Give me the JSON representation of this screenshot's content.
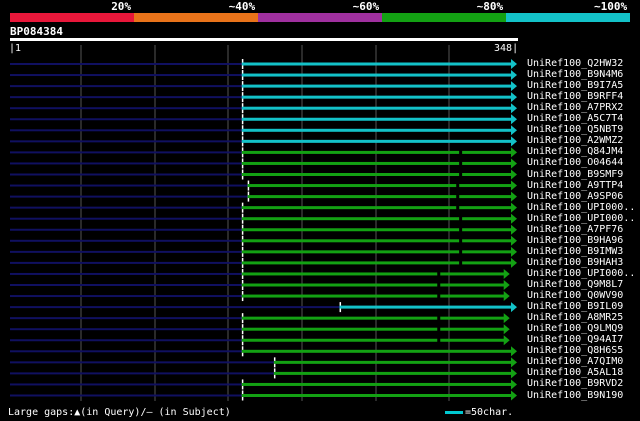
{
  "legend": {
    "segments": [
      {
        "label": "20%",
        "color": "#e8173a"
      },
      {
        "label": "~40%",
        "color": "#e8731a"
      },
      {
        "label": "~60%",
        "color": "#a0309f"
      },
      {
        "label": "~80%",
        "color": "#13a113"
      },
      {
        "label": "~100%",
        "color": "#13c2c8"
      }
    ]
  },
  "query": {
    "id": "BP084384",
    "length": 348,
    "scale_start": "1",
    "scale_end": "348"
  },
  "colors": {
    "grid": "#555555",
    "unaligned": "#101060",
    "cyan": "#13c2c8",
    "green": "#13a113",
    "gap_mark": "#000000"
  },
  "hits": [
    {
      "name": "UniRef100_Q2HW32",
      "start": 160,
      "end": 348,
      "color": "cyan"
    },
    {
      "name": "UniRef100_B9N4M6",
      "start": 160,
      "end": 348,
      "color": "cyan"
    },
    {
      "name": "UniRef100_B9I7A5",
      "start": 160,
      "end": 348,
      "color": "cyan"
    },
    {
      "name": "UniRef100_B9RFF4",
      "start": 160,
      "end": 348,
      "color": "cyan"
    },
    {
      "name": "UniRef100_A7PRX2",
      "start": 160,
      "end": 348,
      "color": "cyan"
    },
    {
      "name": "UniRef100_A5C7T4",
      "start": 160,
      "end": 348,
      "color": "cyan"
    },
    {
      "name": "UniRef100_Q5NBT9",
      "start": 160,
      "end": 348,
      "color": "cyan"
    },
    {
      "name": "UniRef100_A2WMZ2",
      "start": 160,
      "end": 348,
      "color": "cyan"
    },
    {
      "name": "UniRef100_Q84JM4",
      "start": 160,
      "end": 348,
      "color": "green",
      "gap": 309
    },
    {
      "name": "UniRef100_O04644",
      "start": 160,
      "end": 348,
      "color": "green",
      "gap": 309
    },
    {
      "name": "UniRef100_B9SMF9",
      "start": 160,
      "end": 348,
      "color": "green",
      "gap": 309
    },
    {
      "name": "UniRef100_A9TTP4",
      "start": 164,
      "end": 348,
      "color": "green",
      "gap": 307
    },
    {
      "name": "UniRef100_A9SP06",
      "start": 164,
      "end": 348,
      "color": "green",
      "gap": 307
    },
    {
      "name": "UniRef100_UPI000..",
      "start": 160,
      "end": 348,
      "color": "green",
      "gap": 307
    },
    {
      "name": "UniRef100_UPI000..",
      "start": 160,
      "end": 348,
      "color": "green",
      "gap": 309
    },
    {
      "name": "UniRef100_A7PF76",
      "start": 160,
      "end": 348,
      "color": "green",
      "gap": 309
    },
    {
      "name": "UniRef100_B9HA96",
      "start": 160,
      "end": 348,
      "color": "green",
      "gap": 309
    },
    {
      "name": "UniRef100_B9IMW3",
      "start": 160,
      "end": 348,
      "color": "green",
      "gap": 309
    },
    {
      "name": "UniRef100_B9HAH3",
      "start": 160,
      "end": 348,
      "color": "green",
      "gap": 309
    },
    {
      "name": "UniRef100_UPI000..",
      "start": 160,
      "end": 343,
      "color": "green",
      "gap": 294
    },
    {
      "name": "UniRef100_Q9M8L7",
      "start": 160,
      "end": 343,
      "color": "green",
      "gap": 294
    },
    {
      "name": "UniRef100_Q0WV90",
      "start": 160,
      "end": 343,
      "color": "green",
      "gap": 294
    },
    {
      "name": "UniRef100_B9IL09",
      "start": 227,
      "end": 348,
      "color": "cyan"
    },
    {
      "name": "UniRef100_A8MR25",
      "start": 160,
      "end": 343,
      "color": "green",
      "gap": 294
    },
    {
      "name": "UniRef100_Q9LMQ9",
      "start": 160,
      "end": 343,
      "color": "green",
      "gap": 294
    },
    {
      "name": "UniRef100_Q94AI7",
      "start": 160,
      "end": 343,
      "color": "green",
      "gap": 294
    },
    {
      "name": "UniRef100_Q8H6S5",
      "start": 160,
      "end": 348,
      "color": "green"
    },
    {
      "name": "UniRef100_A7QIM0",
      "start": 182,
      "end": 348,
      "color": "green"
    },
    {
      "name": "UniRef100_A5AL18",
      "start": 182,
      "end": 348,
      "color": "green"
    },
    {
      "name": "UniRef100_B9RVD2",
      "start": 160,
      "end": 348,
      "color": "green"
    },
    {
      "name": "UniRef100_B9N190",
      "start": 160,
      "end": 348,
      "color": "green"
    }
  ],
  "footer": {
    "text": "Large gaps:▲(in Query)/— (in Subject)",
    "scale_key": "=50char."
  }
}
